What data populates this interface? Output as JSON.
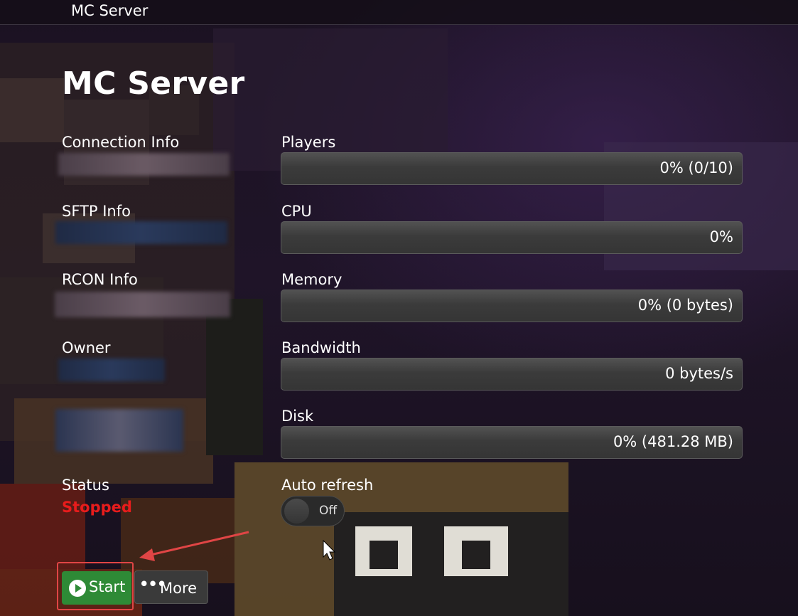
{
  "window": {
    "title": "MC Server"
  },
  "page": {
    "title": "MC Server"
  },
  "info": {
    "connection_label": "Connection Info",
    "sftp_label": "SFTP Info",
    "rcon_label": "RCON Info",
    "owner_label": "Owner"
  },
  "metrics": {
    "players": {
      "label": "Players",
      "value": "0% (0/10)",
      "percent": 0
    },
    "cpu": {
      "label": "CPU",
      "value": "0%",
      "percent": 0
    },
    "memory": {
      "label": "Memory",
      "value": "0% (0 bytes)",
      "percent": 0
    },
    "bandwidth": {
      "label": "Bandwidth",
      "value": "0 bytes/s",
      "percent": 0
    },
    "disk": {
      "label": "Disk",
      "value": "0% (481.28 MB)",
      "percent": 0
    }
  },
  "status": {
    "label": "Status",
    "value": "Stopped",
    "color": "#e81c1c"
  },
  "auto_refresh": {
    "label": "Auto refresh",
    "state": "Off",
    "on": false
  },
  "actions": {
    "start_label": "Start",
    "more_label": "More",
    "start_color": "#2e8a36"
  },
  "annotation": {
    "highlight_color": "#e04545"
  }
}
